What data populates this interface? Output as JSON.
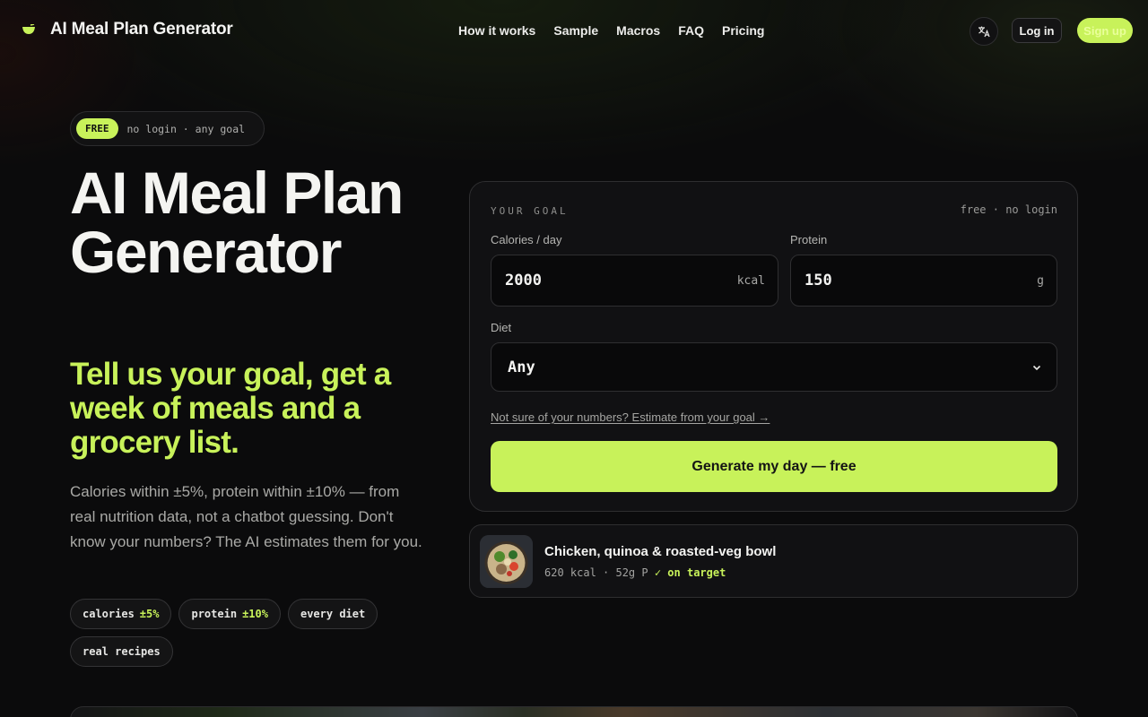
{
  "nav": {
    "brand": "AI Meal Plan Generator",
    "links": [
      "How it works",
      "Sample",
      "Macros",
      "FAQ",
      "Pricing"
    ],
    "login": "Log in",
    "signup": "Sign up",
    "language_icon": "translate-icon"
  },
  "hero": {
    "badge_free": "FREE",
    "badge_text": "no login · any goal",
    "title": "AI Meal Plan Generator",
    "subtitle": "Tell us your goal, get a week of meals and a grocery list.",
    "description": "Calories within ±5%, protein within ±10% — from real nutrition data, not a chatbot guessing. Don't know your numbers? The AI estimates them for you.",
    "chips": [
      {
        "label": "calories",
        "highlight": "±5%"
      },
      {
        "label": "protein",
        "highlight": "±10%"
      },
      {
        "label": "every diet",
        "highlight": ""
      },
      {
        "label": "real recipes",
        "highlight": ""
      }
    ]
  },
  "form": {
    "section_label": "YOUR GOAL",
    "meta": "free · no login",
    "calories_label": "Calories / day",
    "calories_value": "2000",
    "calories_unit": "kcal",
    "protein_label": "Protein",
    "protein_value": "150",
    "protein_unit": "g",
    "diet_label": "Diet",
    "diet_value": "Any",
    "estimate_link": "Not sure of your numbers? Estimate from your goal →",
    "generate_button": "Generate my day — free"
  },
  "meal": {
    "title": "Chicken, quinoa & roasted-veg bowl",
    "kcal": "620 kcal",
    "protein": "52g P",
    "status": "✓ on target"
  },
  "colors": {
    "accent": "#c8f25a",
    "background": "#0b0b0c",
    "card": "#111113"
  }
}
